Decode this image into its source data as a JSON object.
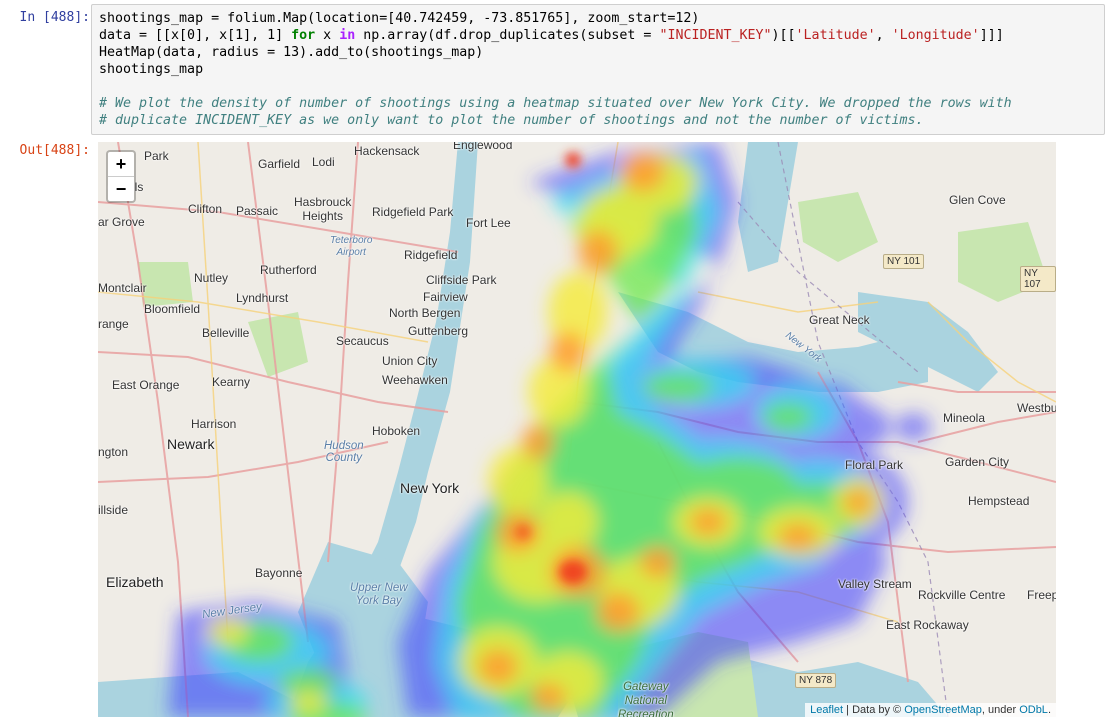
{
  "cell": {
    "in_prompt": "In [488]:",
    "out_prompt": "Out[488]:",
    "code": {
      "l1_a": "shootings_map = folium.Map(location=[40.742459, -73.851765], zoom_start=12)",
      "l2_a": "data = [[x[0], x[1], 1] ",
      "l2_for": "for",
      "l2_b": " x ",
      "l2_in": "in",
      "l2_c": " np.array(df.drop_duplicates(subset = ",
      "l2_str1": "\"INCIDENT_KEY\"",
      "l2_d": ")[[",
      "l2_str2": "'Latitude'",
      "l2_e": ", ",
      "l2_str3": "'Longitude'",
      "l2_f": "]]]",
      "l3": "HeatMap(data, radius = 13).add_to(shootings_map)",
      "l4": "shootings_map",
      "c1": "# We plot the density of number of shootings using a heatmap situated over New York City. We dropped the rows with",
      "c2": "# duplicate INCIDENT_KEY as we only want to plot the number of shootings and not the number of victims."
    }
  },
  "map": {
    "zoom_in": "+",
    "zoom_out": "−",
    "labels": {
      "hackensack": "Hackensack",
      "englewood": "Englewood",
      "park": "Park",
      "garfield": "Garfield",
      "lodi": "Lodi",
      "falls": "e Falls",
      "clifton": "Clifton",
      "passaic": "Passaic",
      "hasbrouck": "Hasbrouck\nHeights",
      "ridgefield_park": "Ridgefield Park",
      "fort_lee": "Fort Lee",
      "glen_cove": "Glen Cove",
      "grove": "ar Grove",
      "teterboro": "Teterboro\nAirport",
      "ridgefield": "Ridgefield",
      "nutley": "Nutley",
      "rutherford": "Rutherford",
      "cliffside": "Cliffside Park",
      "montclair": "Montclair",
      "lyndhurst": "Lyndhurst",
      "fairview": "Fairview",
      "bloomfield": "Bloomfield",
      "north_bergen": "North Bergen",
      "orange": "range",
      "belleville": "Belleville",
      "guttenberg": "Guttenberg",
      "great_neck": "Great Neck",
      "secaucus": "Secaucus",
      "union_city": "Union City",
      "weehawken": "Weehawken",
      "east_orange": "East Orange",
      "kearny": "Kearny",
      "harrison": "Harrison",
      "hoboken": "Hoboken",
      "mineola": "Mineola",
      "westbury": "Westbu",
      "newark": "Newark",
      "hudson": "Hudson\nCounty",
      "floral_park": "Floral Park",
      "garden_city": "Garden City",
      "ngton": "ngton",
      "new_york": "New York",
      "hempstead": "Hempstead",
      "illside": "illside",
      "elizabeth": "Elizabeth",
      "bayonne": "Bayonne",
      "upper_bay": "Upper New\nYork Bay",
      "valley_stream": "Valley Stream",
      "rockville": "Rockville Centre",
      "freeport": "Freep",
      "new_jersey": "New Jersey",
      "east_rockaway": "East Rockaway",
      "gateway": "Gateway\nNational\nRecreation",
      "new_york_river": "New York"
    },
    "shields": {
      "ny101": "NY 101",
      "ny107": "NY 107",
      "ny878": "NY 878"
    },
    "attribution": {
      "leaflet": "Leaflet",
      "sep1": " | Data by © ",
      "osm": "OpenStreetMap",
      "sep2": ", under ",
      "odbl": "ODbL",
      "end": "."
    }
  }
}
